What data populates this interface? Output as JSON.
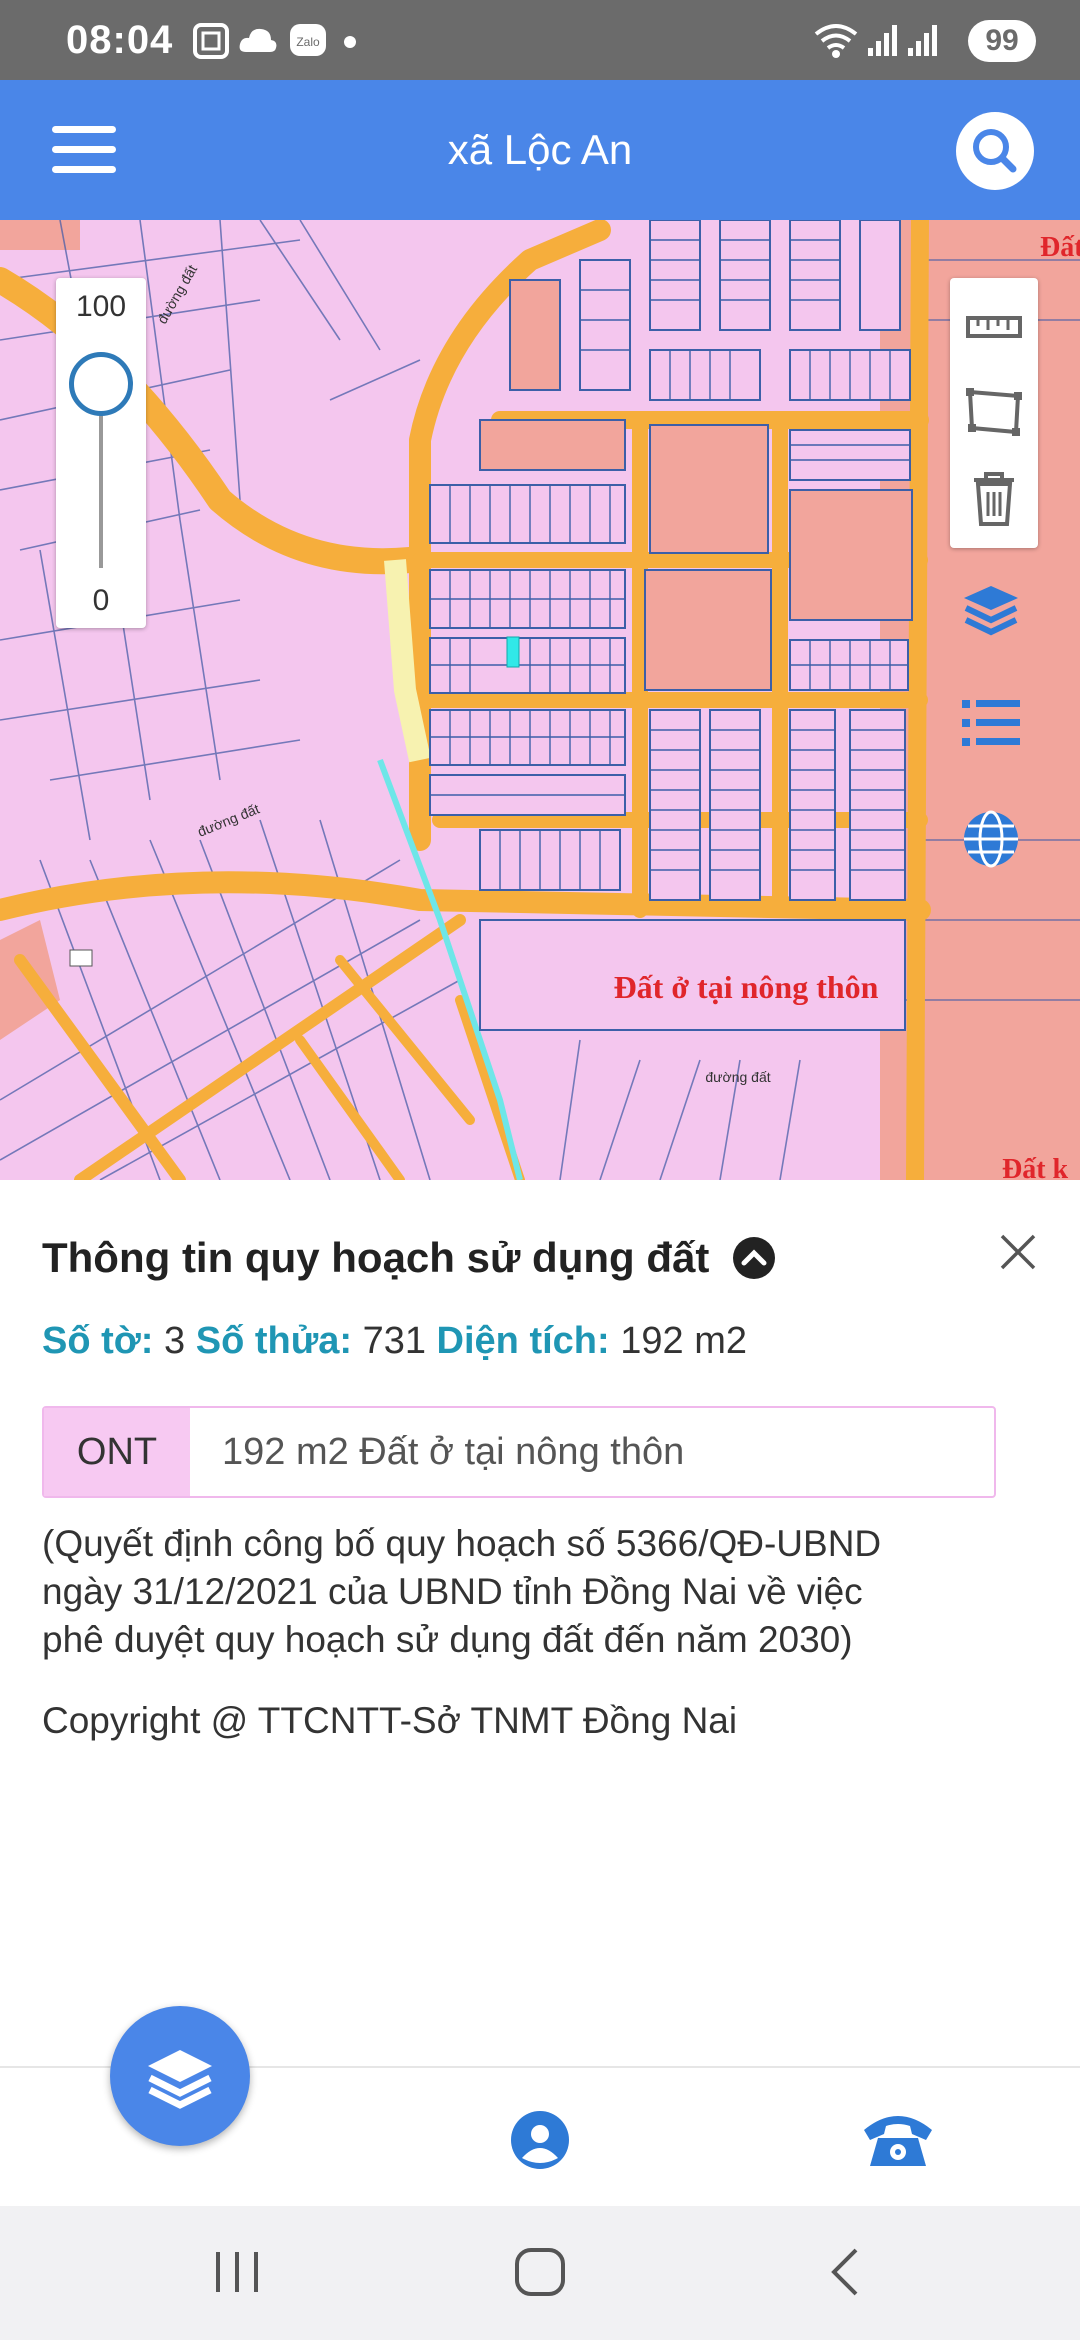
{
  "status_bar": {
    "time": "08:04",
    "battery": "99",
    "icons": [
      "screenshot-icon",
      "cloud-icon",
      "zalo-icon",
      "dot-icon",
      "wifi-icon",
      "signal-icon",
      "signal-icon"
    ]
  },
  "app_bar": {
    "title": "xã Lộc An",
    "menu_icon": "menu-icon",
    "search_icon": "search-icon"
  },
  "map": {
    "zoom_max": "100",
    "zoom_min": "0",
    "zoom_level": 0.85,
    "label_main": "Đất ở tại nông thôn",
    "label_road_1": "đường đất",
    "label_road_2": "đường đất",
    "label_road_3": "đường đất",
    "label_edge_1": "Đất",
    "label_edge_2": "Đất k",
    "colors": {
      "residential": "#f4c6ee",
      "road": "#f6ae3c",
      "commercial": "#f2a59c",
      "river": "#6ee6e8",
      "selected": "#31e8e8",
      "line": "#3c5fa8"
    }
  },
  "info_panel": {
    "title": "Thông tin quy hoạch sử dụng đất",
    "to_label": "Số tờ:",
    "to_value": "3",
    "thua_label": "Số thửa:",
    "thua_value": "731",
    "area_label": "Diện tích:",
    "area_value": "192 m2",
    "zone_code": "ONT",
    "zone_desc": "192 m2 Đất ở tại nông thôn",
    "note_line1": "(Quyết định công bố quy hoạch số 5366/QĐ-UBND",
    "note_line2": "ngày 31/12/2021 của UBND tỉnh Đồng Nai về việc",
    "note_line3": "phê duyệt quy hoạch sử dụng đất đến năm 2030)",
    "copyright": "Copyright @ TTCNTT-Sở TNMT Đồng Nai"
  },
  "bottom_nav": {
    "items": [
      "layers-icon",
      "user-icon",
      "phone-icon"
    ]
  },
  "system_nav": [
    "recents-icon",
    "home-icon",
    "back-icon"
  ]
}
